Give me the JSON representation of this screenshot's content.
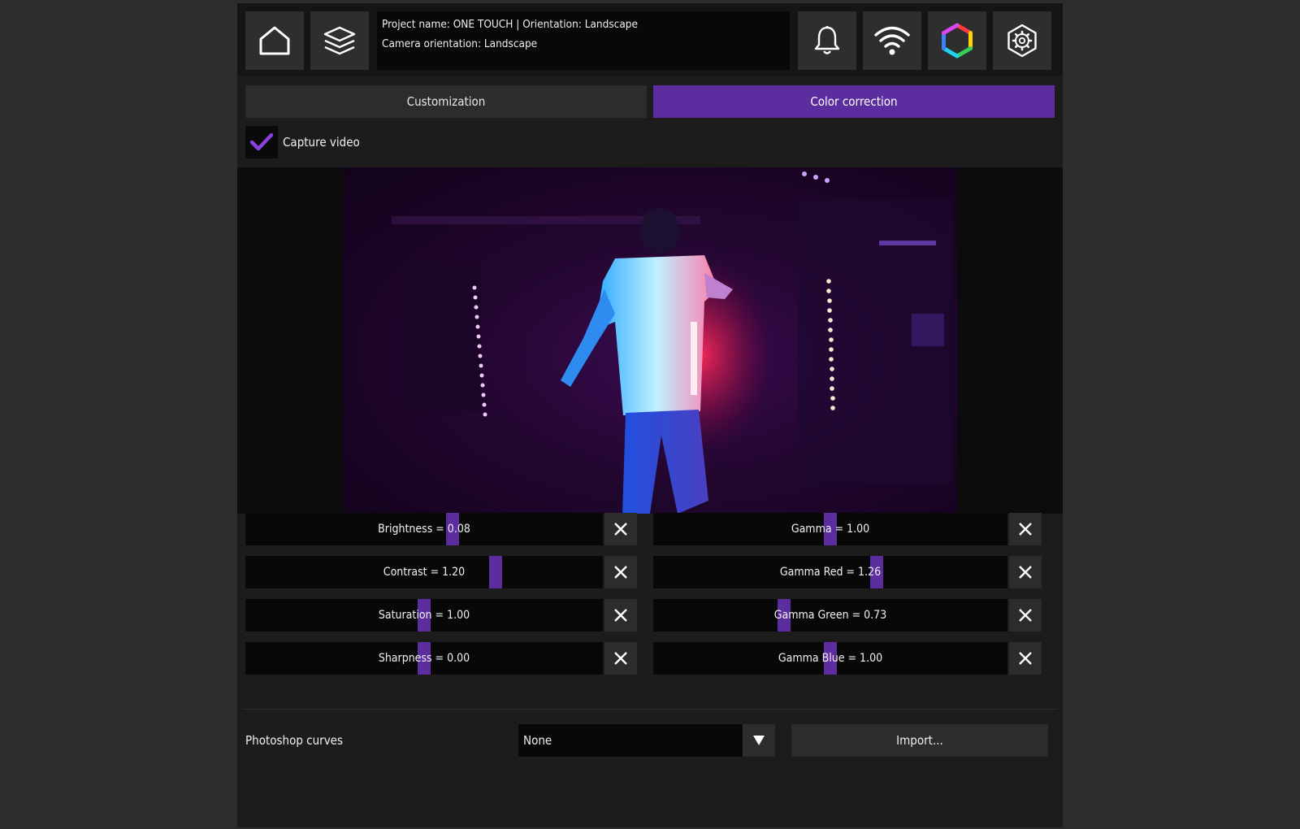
{
  "header": {
    "project_line": "Project name: ONE TOUCH | Orientation: Landscape",
    "camera_line": "Camera orientation: Landscape",
    "icons": [
      "home-icon",
      "layers-icon",
      "bell-icon",
      "wifi-icon",
      "color-hexagon-icon",
      "settings-gear-icon"
    ]
  },
  "tabs": {
    "customization": "Customization",
    "color_correction": "Color correction",
    "active": "color_correction"
  },
  "capture": {
    "label": "Capture video",
    "checked": true
  },
  "colors": {
    "accent": "#5b2d9e",
    "check": "#8a3fe0"
  },
  "sliders": {
    "brightness": {
      "label": "Brightness = 0.08",
      "level": 0.58
    },
    "contrast": {
      "label": "Contrast = 1.20",
      "level": 0.7
    },
    "saturation": {
      "label": "Saturation = 1.00",
      "level": 0.5
    },
    "sharpness": {
      "label": "Sharpness = 0.00",
      "level": 0.5
    },
    "gamma": {
      "label": "Gamma = 1.00",
      "level": 0.5
    },
    "gamma_red": {
      "label": "Gamma Red = 1.26",
      "level": 0.63
    },
    "gamma_green": {
      "label": "Gamma Green = 0.73",
      "level": 0.37
    },
    "gamma_blue": {
      "label": "Gamma Blue = 1.00",
      "level": 0.5
    }
  },
  "curves": {
    "label": "Photoshop curves",
    "selected": "None",
    "import_label": "Import..."
  }
}
